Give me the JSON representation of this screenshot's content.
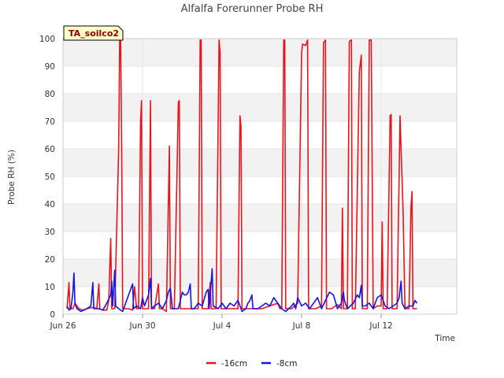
{
  "chart_data": {
    "type": "line",
    "title": "Alfalfa Forerunner Probe RH",
    "xlabel": "Time",
    "ylabel": "Probe RH (%)",
    "site_label": "TA_soilco2",
    "ylim": [
      0,
      100
    ],
    "yticks": [
      0,
      10,
      20,
      30,
      40,
      50,
      60,
      70,
      80,
      90,
      100
    ],
    "xlim": [
      0,
      19.8
    ],
    "xtick_positions": [
      0,
      4,
      8,
      12,
      16
    ],
    "xtick_labels": [
      "Jun 26",
      "Jun 30",
      "Jul 4",
      "Jul 8",
      "Jul 12"
    ],
    "x_unit": "days",
    "grid": true,
    "band_fill": "#f2f2f2",
    "legend_position": "bottom-center",
    "series": [
      {
        "name": "-16cm",
        "color": "#e8141c",
        "points": [
          [
            0.2,
            2
          ],
          [
            0.3,
            11.5
          ],
          [
            0.35,
            2
          ],
          [
            0.5,
            2
          ],
          [
            0.6,
            4
          ],
          [
            0.7,
            3
          ],
          [
            0.8,
            2
          ],
          [
            1.0,
            1.5
          ],
          [
            1.2,
            2
          ],
          [
            1.5,
            2.5
          ],
          [
            1.7,
            2
          ],
          [
            1.8,
            11
          ],
          [
            1.85,
            2
          ],
          [
            2.0,
            1.5
          ],
          [
            2.2,
            1.5
          ],
          [
            2.3,
            5
          ],
          [
            2.4,
            27.5
          ],
          [
            2.45,
            2
          ],
          [
            2.6,
            2
          ],
          [
            2.8,
            60
          ],
          [
            2.85,
            99.5
          ],
          [
            2.9,
            99.5
          ],
          [
            2.95,
            60
          ],
          [
            3.0,
            2
          ],
          [
            3.3,
            2
          ],
          [
            3.5,
            1.5
          ],
          [
            3.6,
            10
          ],
          [
            3.7,
            2
          ],
          [
            3.8,
            2
          ],
          [
            3.9,
            70
          ],
          [
            3.95,
            77.5
          ],
          [
            4.0,
            2
          ],
          [
            4.2,
            2
          ],
          [
            4.3,
            2
          ],
          [
            4.4,
            77.5
          ],
          [
            4.45,
            2
          ],
          [
            4.6,
            2
          ],
          [
            4.8,
            11
          ],
          [
            4.85,
            2
          ],
          [
            5.0,
            2
          ],
          [
            5.2,
            1
          ],
          [
            5.35,
            61
          ],
          [
            5.4,
            2
          ],
          [
            5.6,
            2
          ],
          [
            5.8,
            77
          ],
          [
            5.85,
            77.5
          ],
          [
            5.9,
            2
          ],
          [
            6.2,
            2
          ],
          [
            6.5,
            2
          ],
          [
            6.8,
            2
          ],
          [
            6.9,
            99.5
          ],
          [
            6.95,
            99.5
          ],
          [
            7.0,
            2
          ],
          [
            7.3,
            2
          ],
          [
            7.4,
            11.5
          ],
          [
            7.45,
            2
          ],
          [
            7.7,
            2
          ],
          [
            7.85,
            99.5
          ],
          [
            7.9,
            95
          ],
          [
            7.95,
            2
          ],
          [
            8.3,
            2
          ],
          [
            8.6,
            2
          ],
          [
            8.8,
            2
          ],
          [
            8.9,
            72
          ],
          [
            8.95,
            68
          ],
          [
            9.0,
            2
          ],
          [
            9.3,
            2
          ],
          [
            9.6,
            2
          ],
          [
            10.0,
            2
          ],
          [
            10.4,
            3
          ],
          [
            10.8,
            4
          ],
          [
            10.9,
            2
          ],
          [
            11.0,
            2
          ],
          [
            11.1,
            99.5
          ],
          [
            11.15,
            99.5
          ],
          [
            11.2,
            2
          ],
          [
            11.5,
            2
          ],
          [
            11.8,
            4
          ],
          [
            12.0,
            95
          ],
          [
            12.05,
            98
          ],
          [
            12.2,
            97.5
          ],
          [
            12.3,
            99.5
          ],
          [
            12.35,
            2
          ],
          [
            12.7,
            2
          ],
          [
            13.0,
            3
          ],
          [
            13.1,
            98.5
          ],
          [
            13.2,
            99.5
          ],
          [
            13.25,
            2
          ],
          [
            13.5,
            2
          ],
          [
            13.8,
            3.5
          ],
          [
            14.0,
            2
          ],
          [
            14.05,
            38.5
          ],
          [
            14.1,
            2
          ],
          [
            14.3,
            2
          ],
          [
            14.4,
            99
          ],
          [
            14.5,
            99.5
          ],
          [
            14.55,
            2
          ],
          [
            14.7,
            2
          ],
          [
            14.9,
            88
          ],
          [
            15.0,
            94
          ],
          [
            15.05,
            2
          ],
          [
            15.3,
            2
          ],
          [
            15.4,
            99.5
          ],
          [
            15.5,
            99.5
          ],
          [
            15.6,
            2
          ],
          [
            15.8,
            3
          ],
          [
            16.0,
            3
          ],
          [
            16.05,
            33.5
          ],
          [
            16.1,
            2
          ],
          [
            16.3,
            2
          ],
          [
            16.45,
            72
          ],
          [
            16.5,
            72.5
          ],
          [
            16.55,
            2
          ],
          [
            16.8,
            2
          ],
          [
            16.95,
            72
          ],
          [
            17.0,
            60
          ],
          [
            17.1,
            38
          ],
          [
            17.2,
            2
          ],
          [
            17.4,
            2
          ],
          [
            17.5,
            39
          ],
          [
            17.55,
            44.5
          ],
          [
            17.6,
            2
          ],
          [
            17.8,
            2
          ]
        ]
      },
      {
        "name": "-8cm",
        "color": "#1414e6",
        "points": [
          [
            0.2,
            3
          ],
          [
            0.3,
            1.5
          ],
          [
            0.4,
            2
          ],
          [
            0.5,
            8
          ],
          [
            0.55,
            15
          ],
          [
            0.6,
            4
          ],
          [
            0.7,
            2
          ],
          [
            0.9,
            1
          ],
          [
            1.2,
            2
          ],
          [
            1.4,
            3
          ],
          [
            1.5,
            11.5
          ],
          [
            1.55,
            2
          ],
          [
            1.8,
            2
          ],
          [
            2.0,
            1.5
          ],
          [
            2.2,
            4
          ],
          [
            2.4,
            7
          ],
          [
            2.45,
            12
          ],
          [
            2.5,
            3
          ],
          [
            2.6,
            16
          ],
          [
            2.65,
            3
          ],
          [
            2.8,
            2
          ],
          [
            3.0,
            1
          ],
          [
            3.3,
            7
          ],
          [
            3.5,
            11
          ],
          [
            3.55,
            2
          ],
          [
            3.7,
            3
          ],
          [
            3.9,
            2
          ],
          [
            4.0,
            6
          ],
          [
            4.1,
            3
          ],
          [
            4.3,
            7
          ],
          [
            4.4,
            13
          ],
          [
            4.45,
            2
          ],
          [
            4.6,
            3
          ],
          [
            4.8,
            4
          ],
          [
            5.0,
            2
          ],
          [
            5.2,
            5
          ],
          [
            5.3,
            8
          ],
          [
            5.4,
            9.5
          ],
          [
            5.5,
            2
          ],
          [
            5.8,
            2
          ],
          [
            6.0,
            8
          ],
          [
            6.1,
            7
          ],
          [
            6.2,
            7
          ],
          [
            6.3,
            8
          ],
          [
            6.4,
            11
          ],
          [
            6.45,
            2
          ],
          [
            6.6,
            2
          ],
          [
            6.8,
            4
          ],
          [
            7.0,
            3
          ],
          [
            7.2,
            8
          ],
          [
            7.3,
            9
          ],
          [
            7.35,
            2
          ],
          [
            7.5,
            16.5
          ],
          [
            7.55,
            3
          ],
          [
            7.8,
            2
          ],
          [
            8.0,
            4
          ],
          [
            8.2,
            2
          ],
          [
            8.4,
            4
          ],
          [
            8.6,
            3
          ],
          [
            8.8,
            5
          ],
          [
            9.0,
            1
          ],
          [
            9.2,
            2
          ],
          [
            9.3,
            4
          ],
          [
            9.4,
            5
          ],
          [
            9.5,
            7
          ],
          [
            9.55,
            2
          ],
          [
            9.8,
            2
          ],
          [
            10.0,
            3
          ],
          [
            10.2,
            4
          ],
          [
            10.4,
            3
          ],
          [
            10.6,
            6
          ],
          [
            10.8,
            4
          ],
          [
            11.0,
            2
          ],
          [
            11.2,
            1
          ],
          [
            11.5,
            3
          ],
          [
            11.6,
            4
          ],
          [
            11.7,
            2
          ],
          [
            11.8,
            6
          ],
          [
            12.0,
            3
          ],
          [
            12.2,
            4
          ],
          [
            12.4,
            2
          ],
          [
            12.6,
            4
          ],
          [
            12.8,
            6
          ],
          [
            13.0,
            2
          ],
          [
            13.2,
            5
          ],
          [
            13.4,
            8
          ],
          [
            13.6,
            7
          ],
          [
            13.8,
            2
          ],
          [
            14.0,
            4
          ],
          [
            14.1,
            8
          ],
          [
            14.15,
            5
          ],
          [
            14.3,
            2
          ],
          [
            14.6,
            4
          ],
          [
            14.8,
            7
          ],
          [
            14.9,
            6
          ],
          [
            15.0,
            10.5
          ],
          [
            15.05,
            3
          ],
          [
            15.2,
            3
          ],
          [
            15.4,
            4
          ],
          [
            15.6,
            2
          ],
          [
            15.8,
            6
          ],
          [
            16.0,
            7
          ],
          [
            16.2,
            3
          ],
          [
            16.4,
            2
          ],
          [
            16.6,
            3
          ],
          [
            16.8,
            4
          ],
          [
            16.9,
            6
          ],
          [
            17.0,
            12
          ],
          [
            17.05,
            4
          ],
          [
            17.2,
            2
          ],
          [
            17.4,
            3
          ],
          [
            17.6,
            3
          ],
          [
            17.7,
            5
          ],
          [
            17.8,
            4
          ]
        ]
      }
    ]
  },
  "legend": {
    "items": [
      {
        "label": "-16cm",
        "color": "#e8141c"
      },
      {
        "label": "-8cm",
        "color": "#1414e6"
      }
    ]
  }
}
